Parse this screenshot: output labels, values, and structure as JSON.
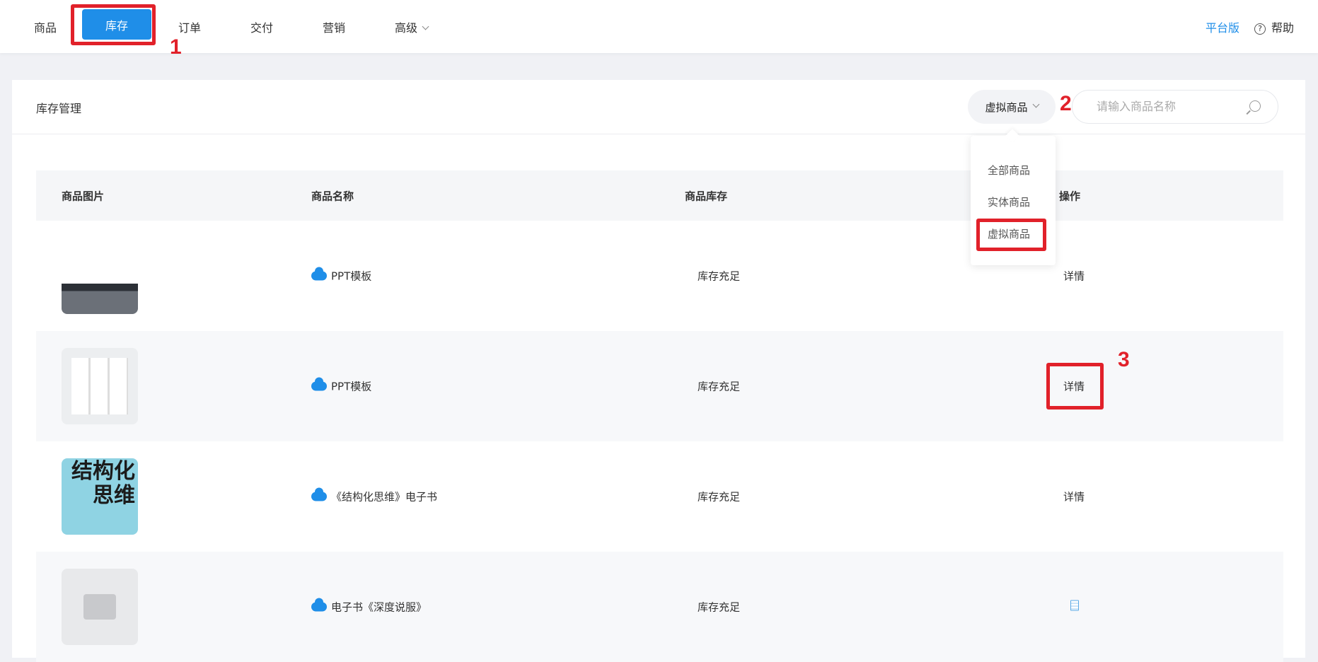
{
  "nav": {
    "items": [
      "商品",
      "库存",
      "订单",
      "交付",
      "营销",
      "高级"
    ],
    "active": "库存",
    "platform": "平台版",
    "help": "帮助"
  },
  "annotations": [
    "1",
    "2",
    "3"
  ],
  "card": {
    "title": "库存管理",
    "filter": {
      "selected": "虚拟商品",
      "options": [
        "全部商品",
        "实体商品",
        "虚拟商品"
      ]
    },
    "search_placeholder": "请输入商品名称"
  },
  "table": {
    "headers": [
      "商品图片",
      "商品名称",
      "商品库存",
      "操作"
    ],
    "rows": [
      {
        "name": "PPT模板",
        "stock": "库存充足",
        "action": "详情"
      },
      {
        "name": "PPT模板",
        "stock": "库存充足",
        "action": "详情"
      },
      {
        "name": "《结构化思维》电子书",
        "stock": "库存充足",
        "action": "详情",
        "cover_text": "结构化思维"
      },
      {
        "name": "电子书《深度说服》",
        "stock": "库存充足",
        "action": "doc-icon"
      }
    ]
  },
  "colors": {
    "accent": "#1f8ee8",
    "annotation": "#e1212a"
  }
}
